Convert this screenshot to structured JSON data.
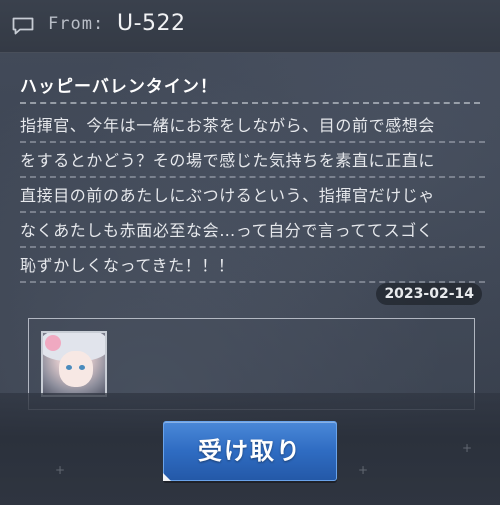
{
  "header": {
    "from_label": "From:",
    "sender": "U-522",
    "icon": "chat-bubble-icon"
  },
  "message": {
    "title": "ハッピーバレンタイン！",
    "lines": [
      "指揮官、今年は一緒にお茶をしながら、目の前で感想会",
      "をするとかどう？その場で感じた気持ちを素直に正直に",
      "直接目の前のあたしにぶつけるという、指揮官だけじゃ",
      "なくあたしも赤面必至な会…って自分で言っててスゴく",
      "恥ずかしくなってきた！！！"
    ],
    "date": "2023-02-14"
  },
  "attachment": {
    "icon": "character-portrait-icon"
  },
  "actions": {
    "receive_label": "受け取り"
  },
  "colors": {
    "background": "#3c4452",
    "button": "#2f6cc2",
    "text": "#e6e8ec"
  }
}
